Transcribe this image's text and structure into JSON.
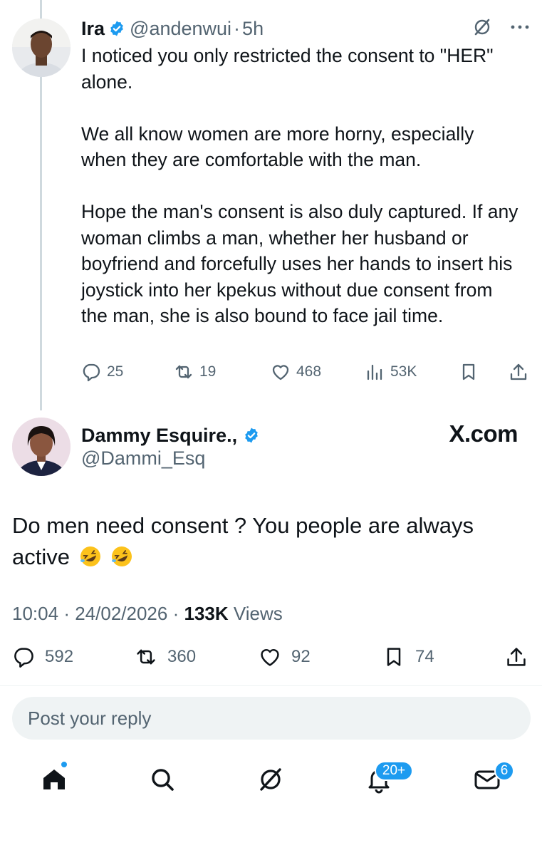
{
  "reply": {
    "author_name": "Ira",
    "handle": "@andenwui",
    "separator": "·",
    "time": "5h",
    "text": "I noticed you only restricted the consent to \"HER\" alone.\n\nWe all know women are more horny, especially when they are comfortable with the man.\n\nHope the man's consent is also duly captured. If any woman climbs a man, whether her husband or boyfriend and forcefully uses her hands to insert his joystick into her kpekus without due consent from the man, she is also bound to face jail time.",
    "stats": {
      "replies": "25",
      "reposts": "19",
      "likes": "468",
      "views": "53K"
    }
  },
  "main_post": {
    "author_name": "Dammy Esquire.,",
    "handle": "@Dammi_Esq",
    "watermark": "X.com",
    "text": "Do men need consent ? You people are always active",
    "emojis": [
      "rolling-on-floor-laughing",
      "rolling-on-floor-laughing"
    ],
    "time": "10:04",
    "date": "24/02/2026",
    "separator": "·",
    "views_count": "133K",
    "views_label": "Views",
    "stats": {
      "replies": "592",
      "reposts": "360",
      "likes": "92",
      "bookmarks": "74"
    }
  },
  "reply_box": {
    "placeholder": "Post your reply"
  },
  "bottom_nav": {
    "items": [
      "home-icon",
      "search-icon",
      "grok-icon",
      "notifications-icon",
      "messages-icon"
    ],
    "notifications_badge": "20+",
    "messages_badge": "6"
  },
  "colors": {
    "accent": "#1d9bf0",
    "text": "#0f1419",
    "secondary": "#536471",
    "thread_line": "#cfd9de",
    "input_bg": "#eff3f4"
  }
}
